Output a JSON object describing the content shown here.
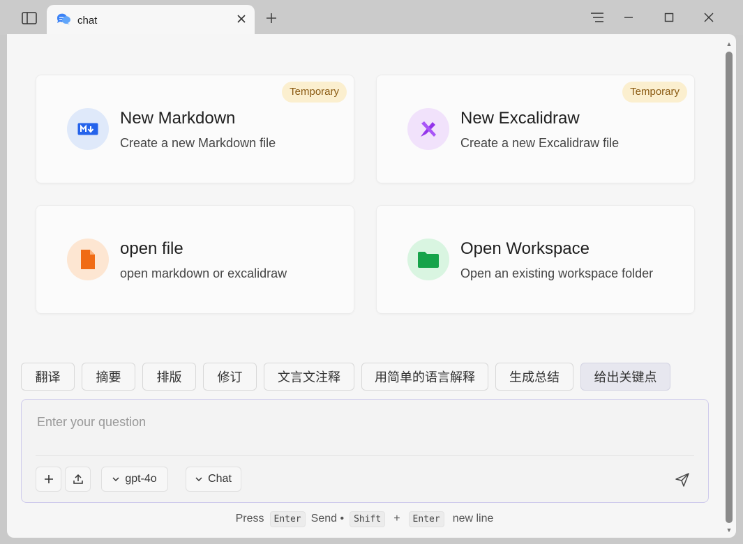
{
  "tab": {
    "label": "chat"
  },
  "cards": [
    {
      "title": "New Markdown",
      "desc": "Create a new Markdown file",
      "badge": "Temporary",
      "icon": "markdown-icon",
      "icon_bg": "#dfe9fa",
      "icon_color": "#2563eb"
    },
    {
      "title": "New Excalidraw",
      "desc": "Create a new Excalidraw file",
      "badge": "Temporary",
      "icon": "excalidraw-icon",
      "icon_bg": "#f1e2fb",
      "icon_color": "#9333ea"
    },
    {
      "title": "open file",
      "desc": "open markdown or excalidraw",
      "icon": "file-icon",
      "icon_bg": "#fde6d2",
      "icon_color": "#f06b14"
    },
    {
      "title": "Open Workspace",
      "desc": "Open an existing workspace folder",
      "icon": "folder-icon",
      "icon_bg": "#d9f5e1",
      "icon_color": "#16a34a"
    }
  ],
  "chips": [
    "翻译",
    "摘要",
    "排版",
    "修订",
    "文言文注释",
    "用简单的语言解释",
    "生成总结",
    "给出关键点"
  ],
  "input": {
    "placeholder": "Enter your question"
  },
  "toolbar": {
    "model": "gpt-4o",
    "mode": "Chat"
  },
  "hint": {
    "press": "Press",
    "enter_key": "Enter",
    "send": "Send •",
    "shift_key": "Shift",
    "plus": "+",
    "enter_key2": "Enter",
    "newline": "new line"
  }
}
